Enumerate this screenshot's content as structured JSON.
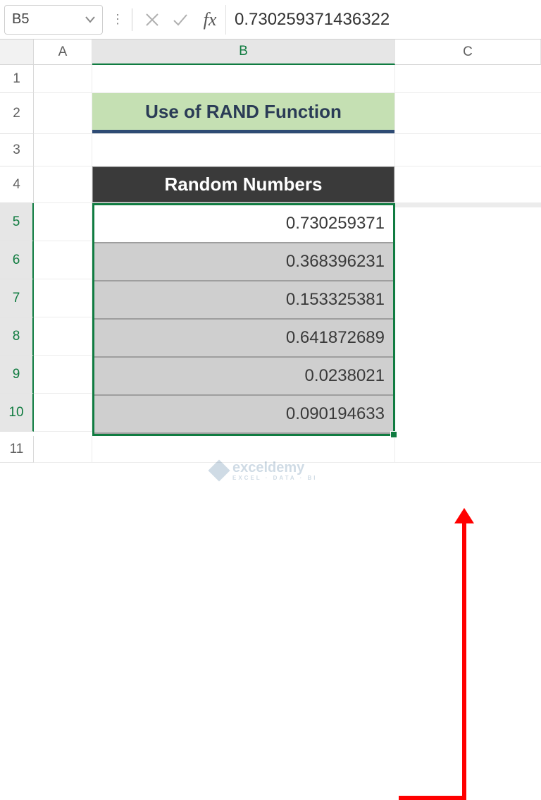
{
  "formula_bar": {
    "cell_ref": "B5",
    "value": "0.730259371436322",
    "fx_label": "fx"
  },
  "columns": {
    "a": "A",
    "b": "B",
    "c": "C"
  },
  "row_labels": [
    "1",
    "2",
    "3",
    "4",
    "5",
    "6",
    "7",
    "8",
    "9",
    "10",
    "11"
  ],
  "title": "Use of RAND Function",
  "header": "Random Numbers",
  "data": [
    "0.730259371",
    "0.368396231",
    "0.153325381",
    "0.641872689",
    "0.0238021",
    "0.090194633"
  ],
  "watermark": {
    "text": "exceldemy",
    "sub": "EXCEL · DATA · BI"
  }
}
